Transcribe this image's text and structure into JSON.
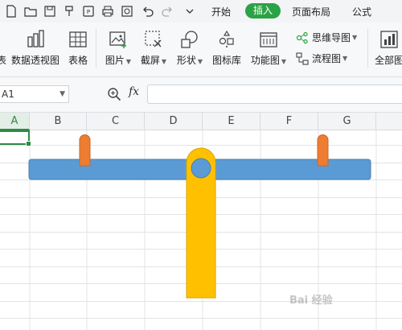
{
  "menu": {
    "items": [
      "开始",
      "插入",
      "页面布局",
      "公式"
    ],
    "active": "插入"
  },
  "ribbon": {
    "pivot_label": "数据透视图",
    "table_label": "表格",
    "picture_label": "图片",
    "screenshot_label": "截屏",
    "shapes_label": "形状",
    "iconlib_label": "图标库",
    "funcchart_label": "功能图",
    "mindmap_label": "思维导图",
    "flowchart_label": "流程图",
    "allchart_label": "全部图",
    "cut_off_left_label": "表"
  },
  "formula_bar": {
    "name_box": "A1",
    "fx": "fx",
    "formula_value": ""
  },
  "grid": {
    "columns": [
      "A",
      "B",
      "C",
      "D",
      "E",
      "F",
      "G"
    ],
    "selected_column": "A",
    "selected_cell": "A1"
  },
  "colors": {
    "accent": "#2ba245",
    "beam": "#5b9bd5",
    "post": "#ffc000",
    "pin": "#ed7d31"
  },
  "watermark": "Bai 经验"
}
